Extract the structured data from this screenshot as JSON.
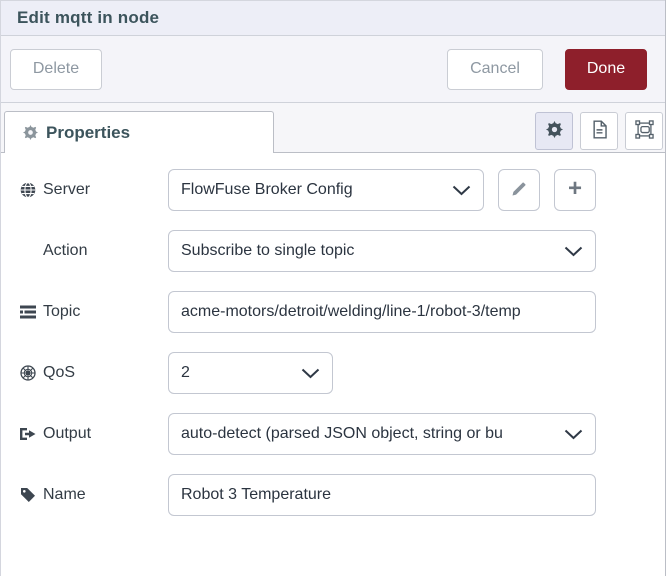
{
  "dialog": {
    "title": "Edit mqtt in node",
    "toolbar": {
      "delete_label": "Delete",
      "cancel_label": "Cancel",
      "done_label": "Done"
    }
  },
  "tabs": {
    "properties_label": "Properties"
  },
  "panel_buttons": {
    "gear": "gear-icon",
    "doc": "doc-icon",
    "appearance": "appearance-icon",
    "active": "gear"
  },
  "form": {
    "server": {
      "label": "Server",
      "value": "FlowFuse Broker Config",
      "icon": "globe-icon"
    },
    "action": {
      "label": "Action",
      "value": "Subscribe to single topic"
    },
    "topic": {
      "label": "Topic",
      "value": "acme-motors/detroit/welding/line-1/robot-3/temp",
      "icon": "tasks-icon"
    },
    "qos": {
      "label": "QoS",
      "value": "2",
      "icon": "empire-icon"
    },
    "output": {
      "label": "Output",
      "value": "auto-detect (parsed JSON object, string or bu",
      "icon": "sign-out-icon"
    },
    "name": {
      "label": "Name",
      "value": "Robot 3 Temperature",
      "icon": "tag-icon"
    }
  },
  "colors": {
    "header_bg": "#edeef7",
    "toolbar_bg": "#f4f4f9",
    "tabbar_bg": "#f6f6f9",
    "title_text": "#3c545c",
    "muted_button_text": "#8e98a2",
    "done_bg": "#8e1f2b",
    "done_text": "#ffffff",
    "border": "#cfd2da",
    "input_border": "#c3c7d1",
    "input_text": "#2b3440",
    "active_icon_bg": "#e7e8f4"
  },
  "icons": {
    "select_chevron": "chevron-down-icon",
    "server_edit": "pencil-icon",
    "server_add": "plus-icon"
  }
}
